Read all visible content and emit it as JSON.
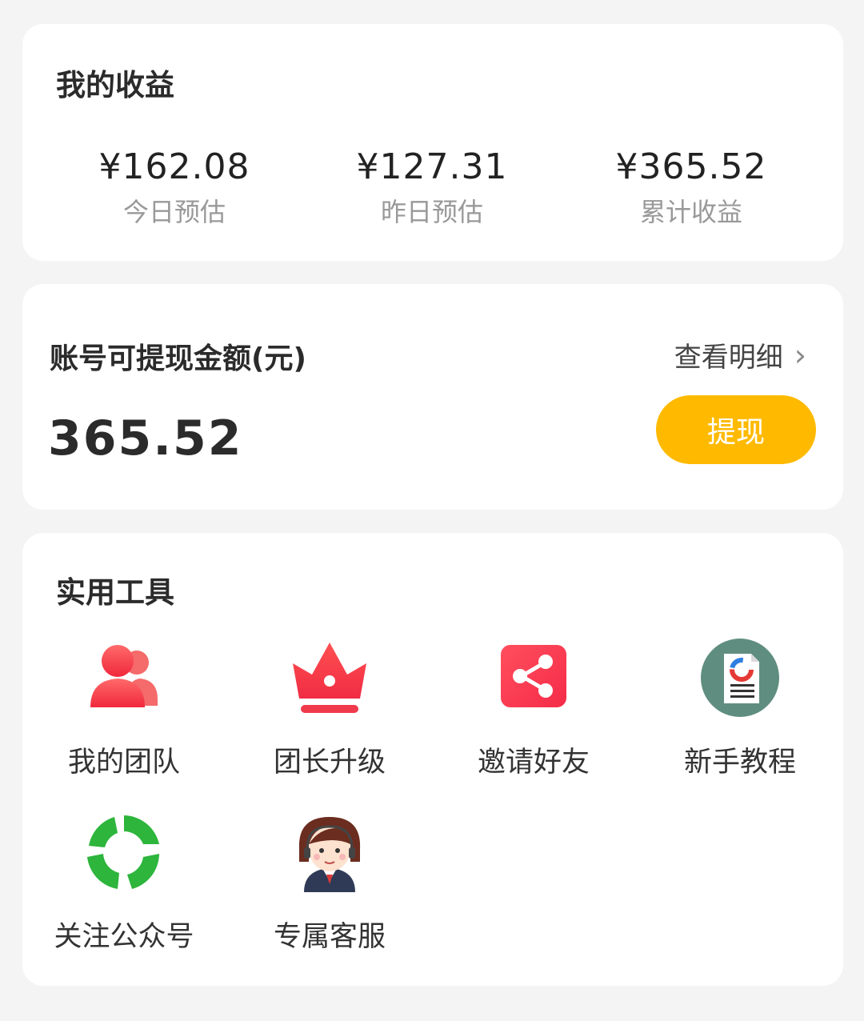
{
  "earnings": {
    "title": "我的收益",
    "stats": [
      {
        "value": "¥162.08",
        "label": "今日预估"
      },
      {
        "value": "¥127.31",
        "label": "昨日预估"
      },
      {
        "value": "¥365.52",
        "label": "累计收益"
      }
    ]
  },
  "balance": {
    "title": "账号可提现金额(元)",
    "detail_label": "查看明细",
    "amount": "365.52",
    "withdraw_label": "提现",
    "accent": "#ffba00"
  },
  "tools": {
    "title": "实用工具",
    "items": [
      {
        "label": "我的团队",
        "icon": "team-icon"
      },
      {
        "label": "团长升级",
        "icon": "crown-icon"
      },
      {
        "label": "邀请好友",
        "icon": "share-icon"
      },
      {
        "label": "新手教程",
        "icon": "tutorial-icon"
      },
      {
        "label": "关注公众号",
        "icon": "wechat-follow-icon"
      },
      {
        "label": "专属客服",
        "icon": "customer-service-icon"
      }
    ]
  }
}
